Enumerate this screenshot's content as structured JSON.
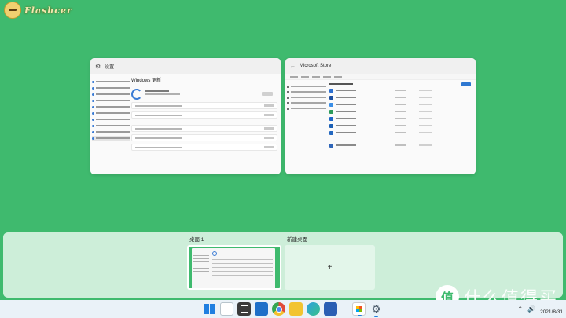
{
  "watermark": {
    "brand": "Flashcer"
  },
  "windows": {
    "settings": {
      "title": "设置",
      "page_title": "Windows 更新"
    },
    "store": {
      "title": "Microsoft Store"
    }
  },
  "desktops": [
    {
      "label": "桌面 1"
    },
    {
      "label": "新建桌面",
      "add_symbol": "+"
    }
  ],
  "taskbar": {
    "icons": [
      "windows-start-icon",
      "search-icon",
      "task-view-icon",
      "widgets-icon",
      "chrome-icon",
      "file-explorer-icon",
      "edge-icon",
      "krita-icon",
      "microsoft-store-icon",
      "settings-icon"
    ],
    "tray": {
      "chevron": "⌃",
      "speaker": "🔊",
      "clock_time": "",
      "clock_date": "2021/8/31"
    }
  },
  "smzdm": {
    "badge": "值",
    "text": "什么值得买"
  }
}
